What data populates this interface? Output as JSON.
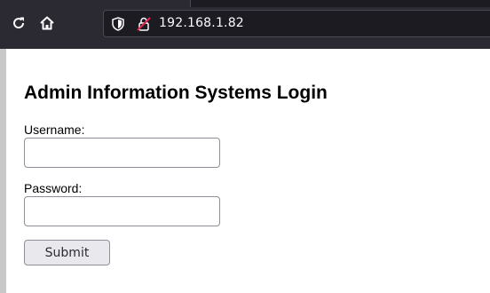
{
  "browser": {
    "url": "192.168.1.82",
    "icons": {
      "reload": "reload-icon",
      "home": "home-icon",
      "tracking": "shield-icon",
      "security": "insecure-lock-icon"
    }
  },
  "login": {
    "title": "Admin Information Systems Login",
    "username_label": "Username:",
    "username_value": "",
    "password_label": "Password:",
    "password_value": "",
    "submit_label": "Submit"
  },
  "colors": {
    "chrome_bg": "#2b2a33",
    "urlbar_bg": "#1c1b22",
    "insecure_red": "#e22850"
  }
}
